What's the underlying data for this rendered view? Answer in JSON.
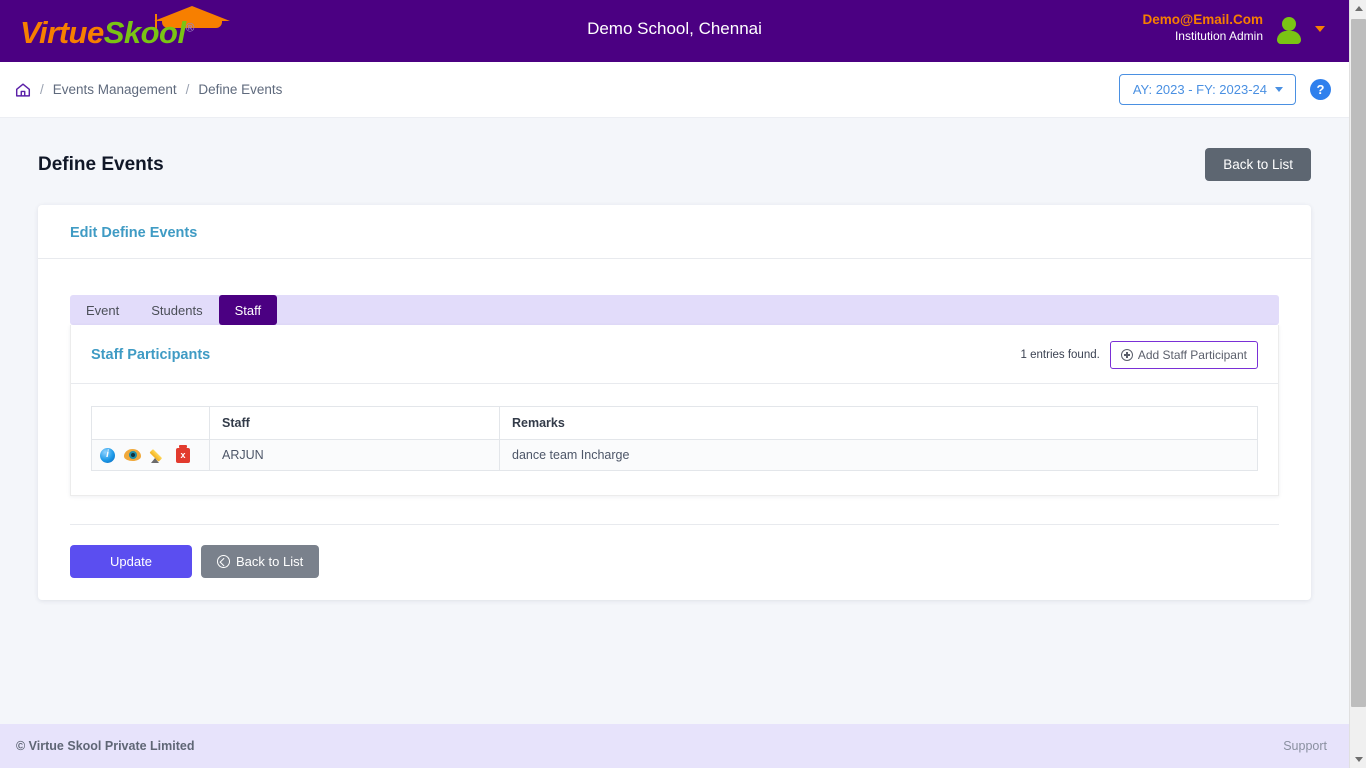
{
  "header": {
    "brand_virtue": "Virtue",
    "brand_skool": "Skool",
    "brand_reg": "®",
    "school_name": "Demo School, Chennai",
    "user_email": "Demo@Email.Com",
    "user_role": "Institution Admin",
    "avatar_icon": "user-avatar-icon",
    "chevron_icon": "chevron-down-icon",
    "colors": {
      "bar": "#4b0082",
      "brand_orange": "#f77f00",
      "brand_green": "#7ac414"
    }
  },
  "breadcrumb": {
    "home_icon": "home-icon",
    "separator": "/",
    "items": [
      {
        "label": "Events Management"
      },
      {
        "label": "Define Events"
      }
    ],
    "academic_year": "AY: 2023 - FY: 2023-24",
    "help_label": "?"
  },
  "page": {
    "title": "Define Events",
    "back_to_list_top": "Back to List"
  },
  "card": {
    "title": "Edit Define Events",
    "tabs": [
      {
        "label": "Event",
        "active": false
      },
      {
        "label": "Students",
        "active": false
      },
      {
        "label": "Staff",
        "active": true
      }
    ]
  },
  "panel": {
    "title": "Staff Participants",
    "entries_found": "1 entries found.",
    "add_button": "Add Staff Participant",
    "add_button_icon": "plus-circle-icon"
  },
  "table": {
    "columns": [
      "",
      "Staff",
      "Remarks"
    ],
    "rows": [
      {
        "actions": [
          "info-icon",
          "view-eye-icon",
          "edit-pencil-icon",
          "delete-icon"
        ],
        "staff": "ARJUN",
        "remarks": "dance team Incharge"
      }
    ]
  },
  "form_actions": {
    "update": "Update",
    "back_to_list": "Back to List",
    "back_icon": "arrow-left-circle-icon"
  },
  "footer": {
    "copyright": "© Virtue Skool Private Limited",
    "support": "Support"
  }
}
